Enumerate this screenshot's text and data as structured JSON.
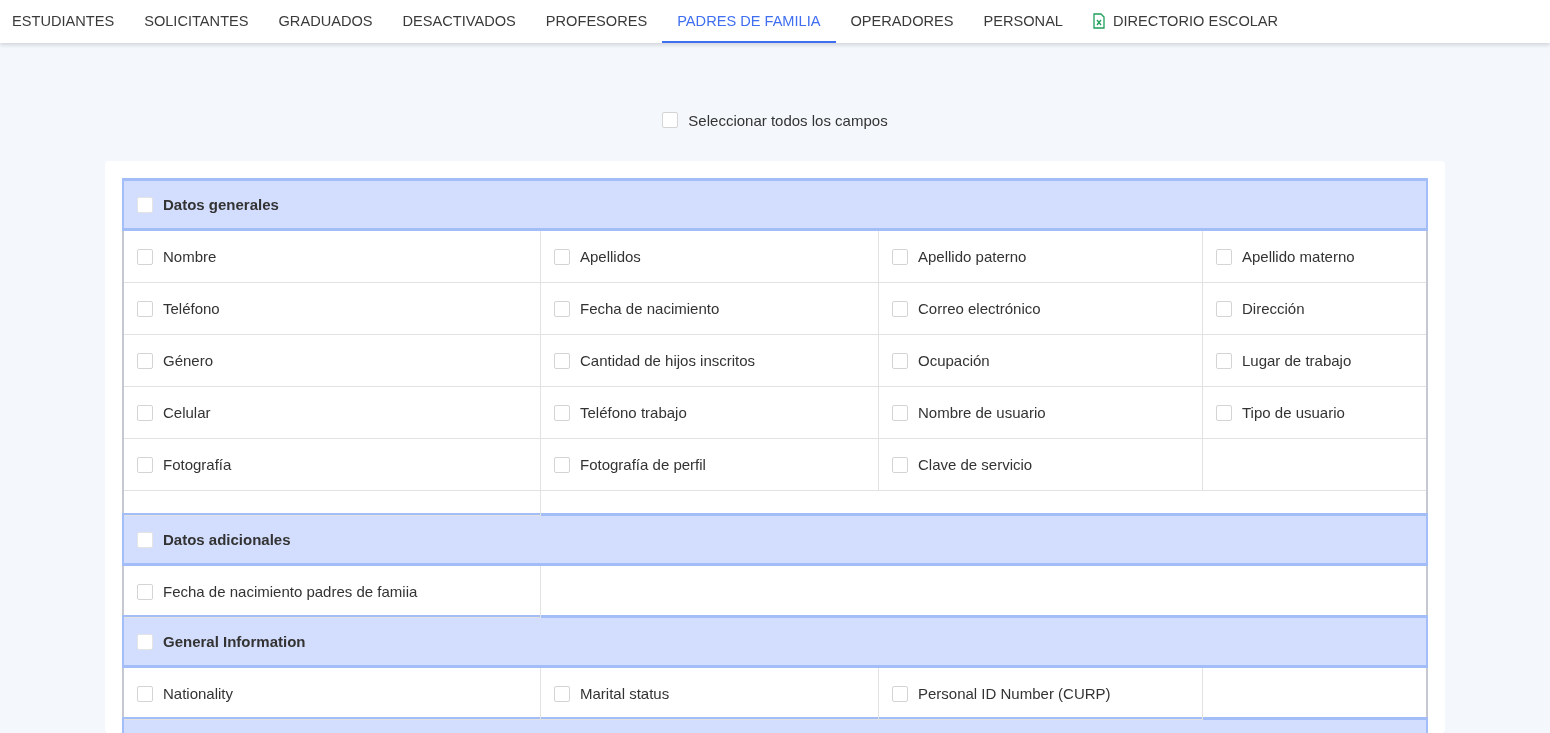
{
  "tabs": [
    {
      "label": "ESTUDIANTES",
      "selected": false
    },
    {
      "label": "SOLICITANTES",
      "selected": false
    },
    {
      "label": "GRADUADOS",
      "selected": false
    },
    {
      "label": "DESACTIVADOS",
      "selected": false
    },
    {
      "label": "PROFESORES",
      "selected": false
    },
    {
      "label": "PADRES DE FAMILIA",
      "selected": true
    },
    {
      "label": "OPERADORES",
      "selected": false
    },
    {
      "label": "PERSONAL",
      "selected": false
    },
    {
      "label": "DIRECTORIO ESCOLAR",
      "selected": false,
      "kind": "export"
    }
  ],
  "select_all": {
    "label": "Seleccionar todos los campos",
    "checked": false
  },
  "sections": [
    {
      "title": "Datos generales",
      "checked": false,
      "fields": [
        {
          "label": "Nombre",
          "checked": false
        },
        {
          "label": "Apellidos",
          "checked": false
        },
        {
          "label": "Apellido paterno",
          "checked": false
        },
        {
          "label": "Apellido materno",
          "checked": false
        },
        {
          "label": "Teléfono",
          "checked": false
        },
        {
          "label": "Fecha de nacimiento",
          "checked": false
        },
        {
          "label": "Correo electrónico",
          "checked": false
        },
        {
          "label": "Dirección",
          "checked": false
        },
        {
          "label": "Género",
          "checked": false
        },
        {
          "label": "Cantidad de hijos inscritos",
          "checked": false
        },
        {
          "label": "Ocupación",
          "checked": false
        },
        {
          "label": "Lugar de trabajo",
          "checked": false
        },
        {
          "label": "Celular",
          "checked": false
        },
        {
          "label": "Teléfono trabajo",
          "checked": false
        },
        {
          "label": "Nombre de usuario",
          "checked": false
        },
        {
          "label": "Tipo de usuario",
          "checked": false
        },
        {
          "label": "Fotografía",
          "checked": false
        },
        {
          "label": "Fotografía de perfil",
          "checked": false
        },
        {
          "label": "Clave de servicio",
          "checked": false
        }
      ]
    },
    {
      "title": "Datos adicionales",
      "checked": false,
      "fields": [
        {
          "label": "Fecha de nacimiento padres de famiia",
          "checked": false
        }
      ]
    },
    {
      "title": "General Information",
      "checked": false,
      "fields": [
        {
          "label": "Nationality",
          "checked": false
        },
        {
          "label": "Marital status",
          "checked": false
        },
        {
          "label": "Personal ID Number (CURP)",
          "checked": false
        }
      ]
    }
  ]
}
